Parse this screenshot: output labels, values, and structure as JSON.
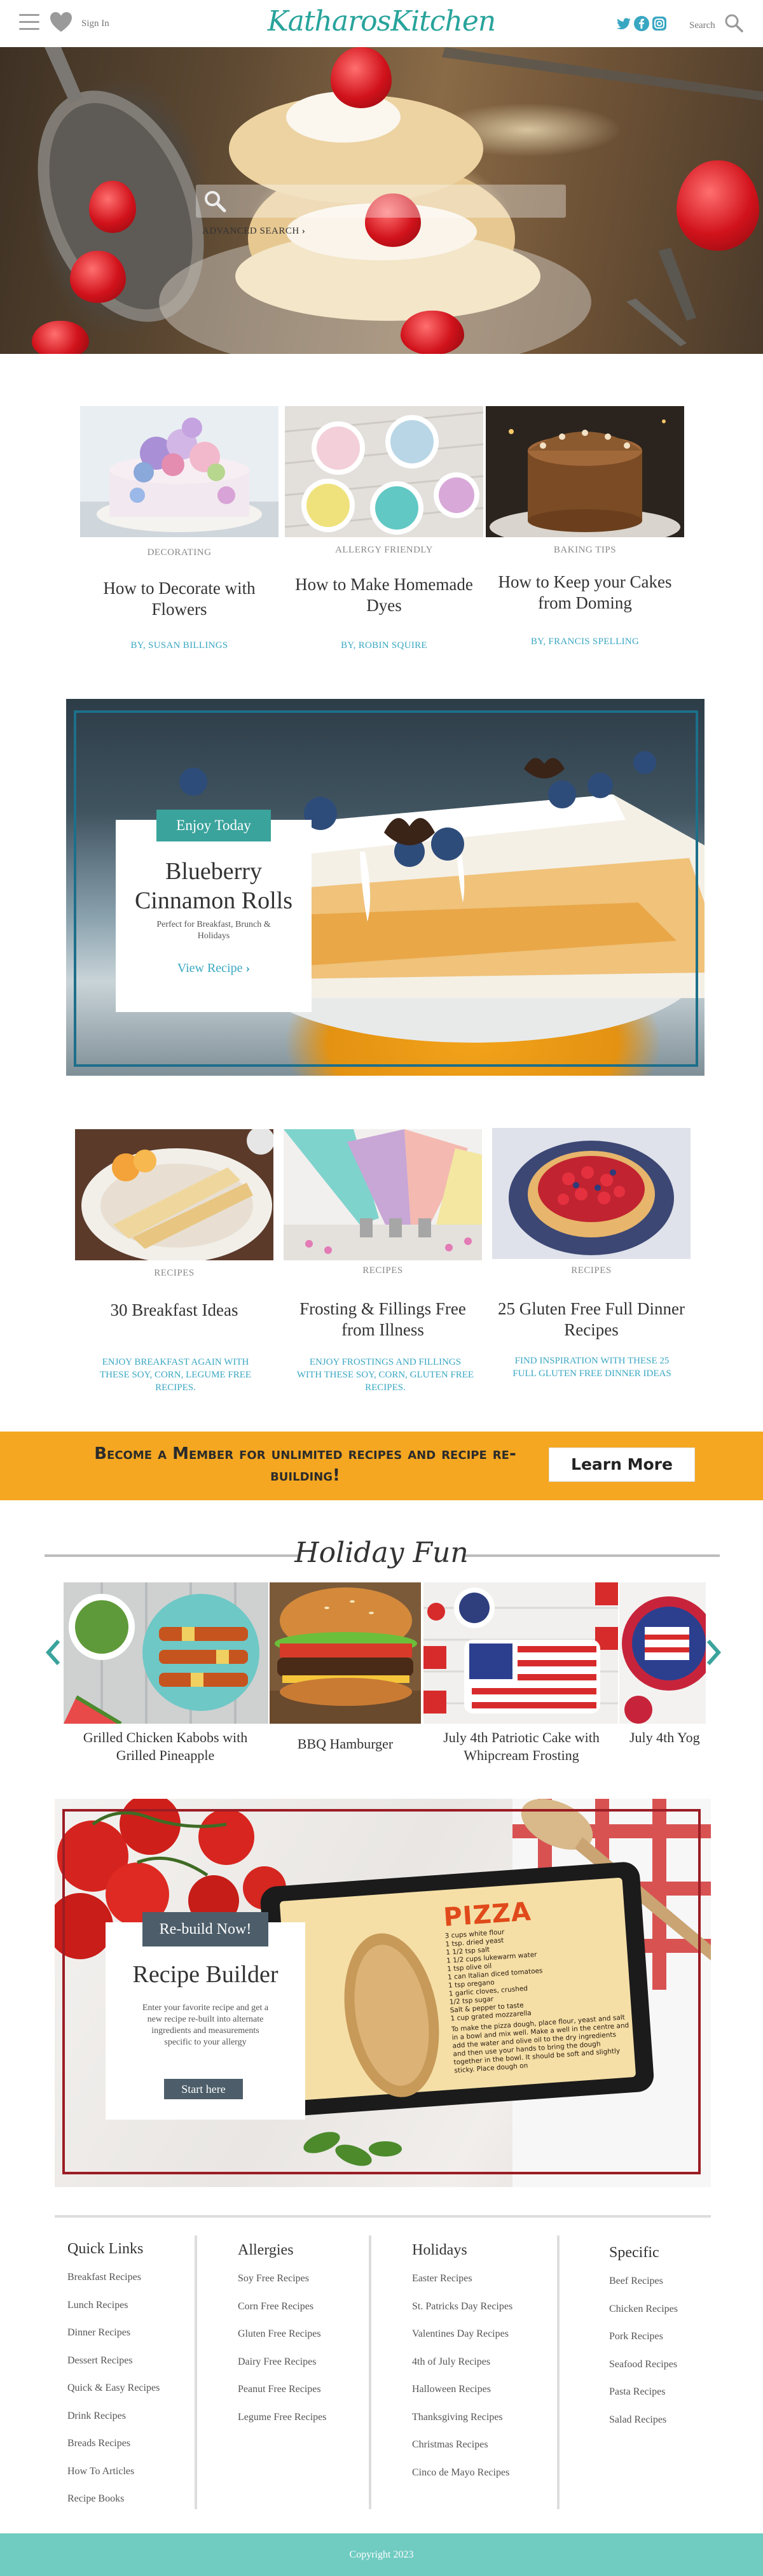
{
  "header": {
    "signin": "Sign In",
    "logo": "KatharosKitchen",
    "search_label": "Search"
  },
  "hero": {
    "search_placeholder": "",
    "advanced_search": "ADVANCED SEARCH"
  },
  "articles": [
    {
      "category": "DECORATING",
      "title": "How to Decorate with Flowers",
      "byline": "BY, SUSAN BILLINGS"
    },
    {
      "category": "ALLERGY FRIENDLY",
      "title": "How to Make Homemade Dyes",
      "byline": "BY, ROBIN SQUIRE"
    },
    {
      "category": "BAKING TIPS",
      "title": "How to Keep your Cakes from Doming",
      "byline": "BY, FRANCIS SPELLING"
    }
  ],
  "feature": {
    "badge": "Enjoy Today",
    "title": "Blueberry Cinnamon Rolls",
    "subtitle": "Perfect for Breakfast, Brunch & Holidays",
    "link": "View Recipe"
  },
  "recipes": [
    {
      "category": "RECIPES",
      "title": "30 Breakfast Ideas",
      "desc": "ENJOY BREAKFAST AGAIN WITH THESE SOY, CORN, LEGUME FREE RECIPES."
    },
    {
      "category": "RECIPES",
      "title": "Frosting & Fillings Free from Illness",
      "desc": "ENJOY FROSTINGS AND FILLINGS WITH THESE SOY, CORN, GLUTEN FREE RECIPES."
    },
    {
      "category": "RECIPES",
      "title": "25 Gluten Free Full Dinner Recipes",
      "desc": "FIND INSPIRATION WITH THESE 25 FULL GLUTEN FREE DINNER IDEAS"
    }
  ],
  "member": {
    "text": "Become a Member for unlimited recipes and recipe re-building!",
    "button": "Learn More"
  },
  "holiday": {
    "title": "Holiday Fun",
    "items": [
      "Grilled Chicken Kabobs with Grilled Pineapple",
      "BBQ Hamburger",
      "July 4th Patriotic Cake with Whipcream Frosting",
      "July 4th Yog"
    ]
  },
  "builder": {
    "badge": "Re-build Now!",
    "title": "Recipe Builder",
    "subtitle": "Enter your favorite recipe and get a new recipe re-built into alternate ingredients and measurements specific to your allergy",
    "button": "Start here",
    "tablet_title": "PIZZA",
    "tablet_lines": [
      "3 cups white flour",
      "1 tsp. dried yeast",
      "1 1/2 tsp salt",
      "1 1/2 cups lukewarm water",
      "1 tsp olive oil",
      "1 can Italian diced tomatoes",
      "1 tsp oregano",
      "1 garlic cloves, crushed",
      "1/2 tsp sugar",
      "Salt & pepper to taste",
      "1 cup grated mozzarella",
      "To make the pizza dough, place flour, yeast and salt in a bowl and mix well. Make a well in the centre and add the water and olive oil to the dry ingredients and then use your hands to bring the dough together in the bowl. It should be soft and slightly sticky. Place dough on"
    ]
  },
  "footer": {
    "columns": [
      {
        "title": "Quick Links",
        "links": [
          "Breakfast Recipes",
          "Lunch Recipes",
          "Dinner Recipes",
          "Dessert Recipes",
          "Quick & Easy Recipes",
          "Drink Recipes",
          "Breads Recipes",
          "How To Articles",
          "Recipe Books"
        ]
      },
      {
        "title": "Allergies",
        "links": [
          "Soy Free Recipes",
          "Corn Free Recipes",
          "Gluten Free Recipes",
          "Dairy Free Recipes",
          "Peanut Free Recipes",
          "Legume Free Recipes"
        ]
      },
      {
        "title": "Holidays",
        "links": [
          "Easter Recipes",
          "St. Patricks Day Recipes",
          "Valentines Day Recipes",
          "4th of July Recipes",
          "Halloween Recipes",
          "Thanksgiving Recipes",
          "Christmas Recipes",
          "Cinco de Mayo Recipes"
        ]
      },
      {
        "title": "Specific",
        "links": [
          "Beef Recipes",
          "Chicken Recipes",
          "Pork Recipes",
          "Seafood Recipes",
          "Pasta Recipes",
          "Salad Recipes"
        ]
      }
    ],
    "copyright": "Copyright 2023"
  },
  "colors": {
    "brand_teal": "#27a39b",
    "link_blue": "#3aa7c2",
    "banner_orange": "#f5a721",
    "builder_red": "#9b1d24",
    "footer_teal": "#70cbc1"
  },
  "icons": [
    "menu-icon",
    "heart-icon",
    "twitter-icon",
    "facebook-icon",
    "instagram-icon",
    "search-icon",
    "chevron-right-icon",
    "chevron-left-icon"
  ]
}
